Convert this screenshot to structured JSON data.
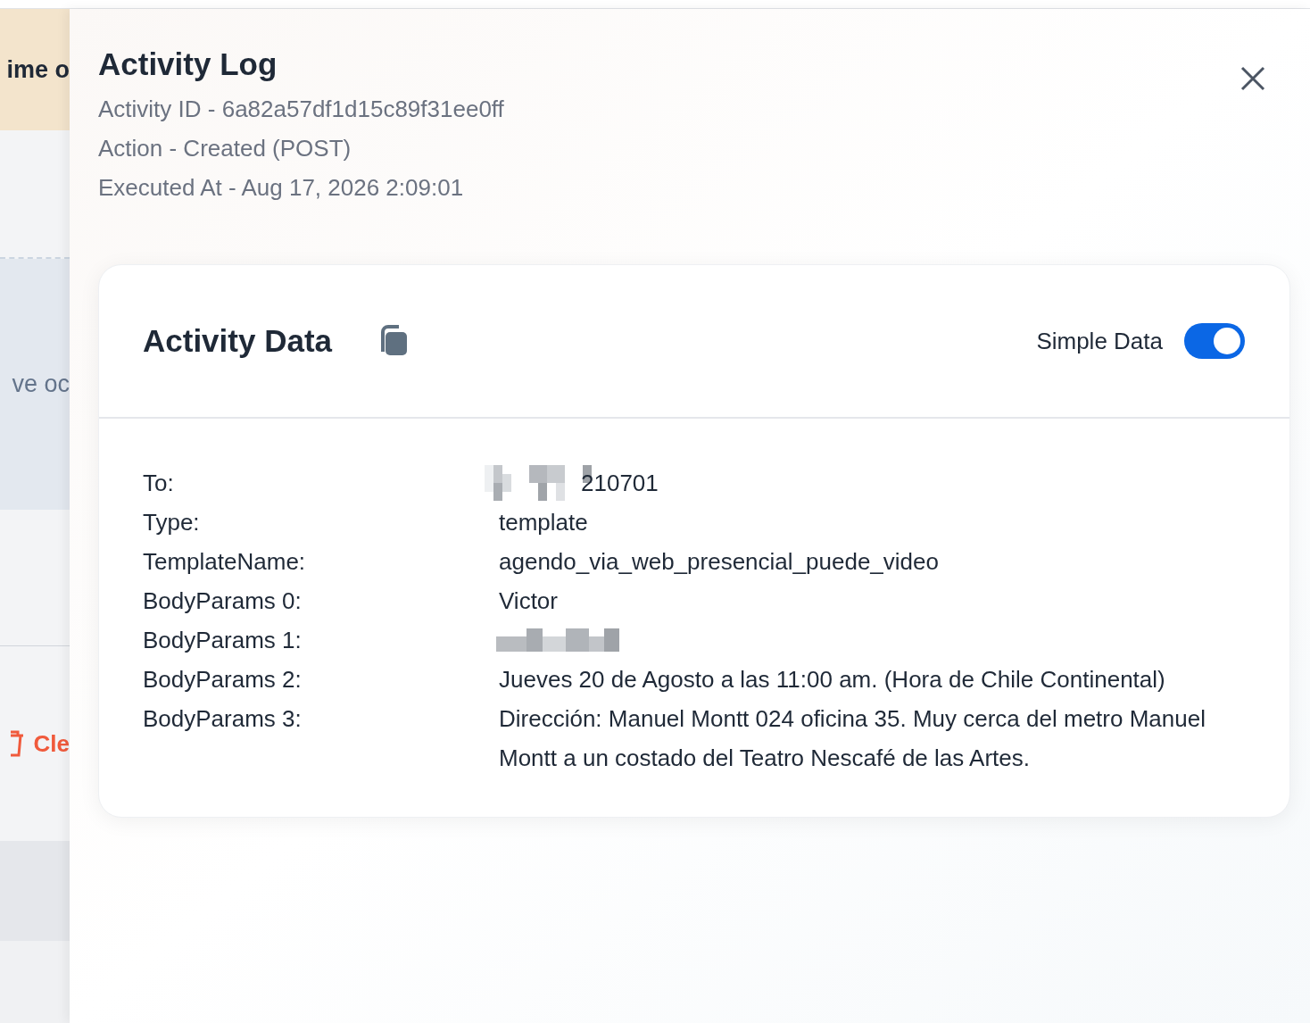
{
  "background_page": {
    "heading_fragment": "ime o",
    "text_fragment": "ve oc",
    "clear_button_fragment": "Cle"
  },
  "drawer": {
    "title": "Activity Log",
    "meta": [
      "Activity ID - 6a82a57df1d15c89f31ee0ff",
      "Action - Created (POST)",
      "Executed At - Aug 17, 2026 2:09:01"
    ],
    "card": {
      "title": "Activity Data",
      "toggle": {
        "label": "Simple Data",
        "on": true
      },
      "rows": [
        {
          "label": "To:",
          "value": "210701",
          "redacted": true
        },
        {
          "label": "Type:",
          "value": "template",
          "redacted": false
        },
        {
          "label": "TemplateName:",
          "value": "agendo_via_web_presencial_puede_video",
          "redacted": false
        },
        {
          "label": "BodyParams 0:",
          "value": "Victor",
          "redacted": false
        },
        {
          "label": "BodyParams 1:",
          "redacted": true
        },
        {
          "label": "BodyParams 2:",
          "value": "Jueves 20 de Agosto a las 11:00 am. (Hora de Chile Continental)",
          "redacted": false
        },
        {
          "label": "BodyParams 3:",
          "value": "Dirección: Manuel Montt 024 oficina 35. Muy cerca del metro Manuel Montt a un costado del Teatro Nescafé de las Artes.",
          "redacted": false
        }
      ]
    }
  }
}
